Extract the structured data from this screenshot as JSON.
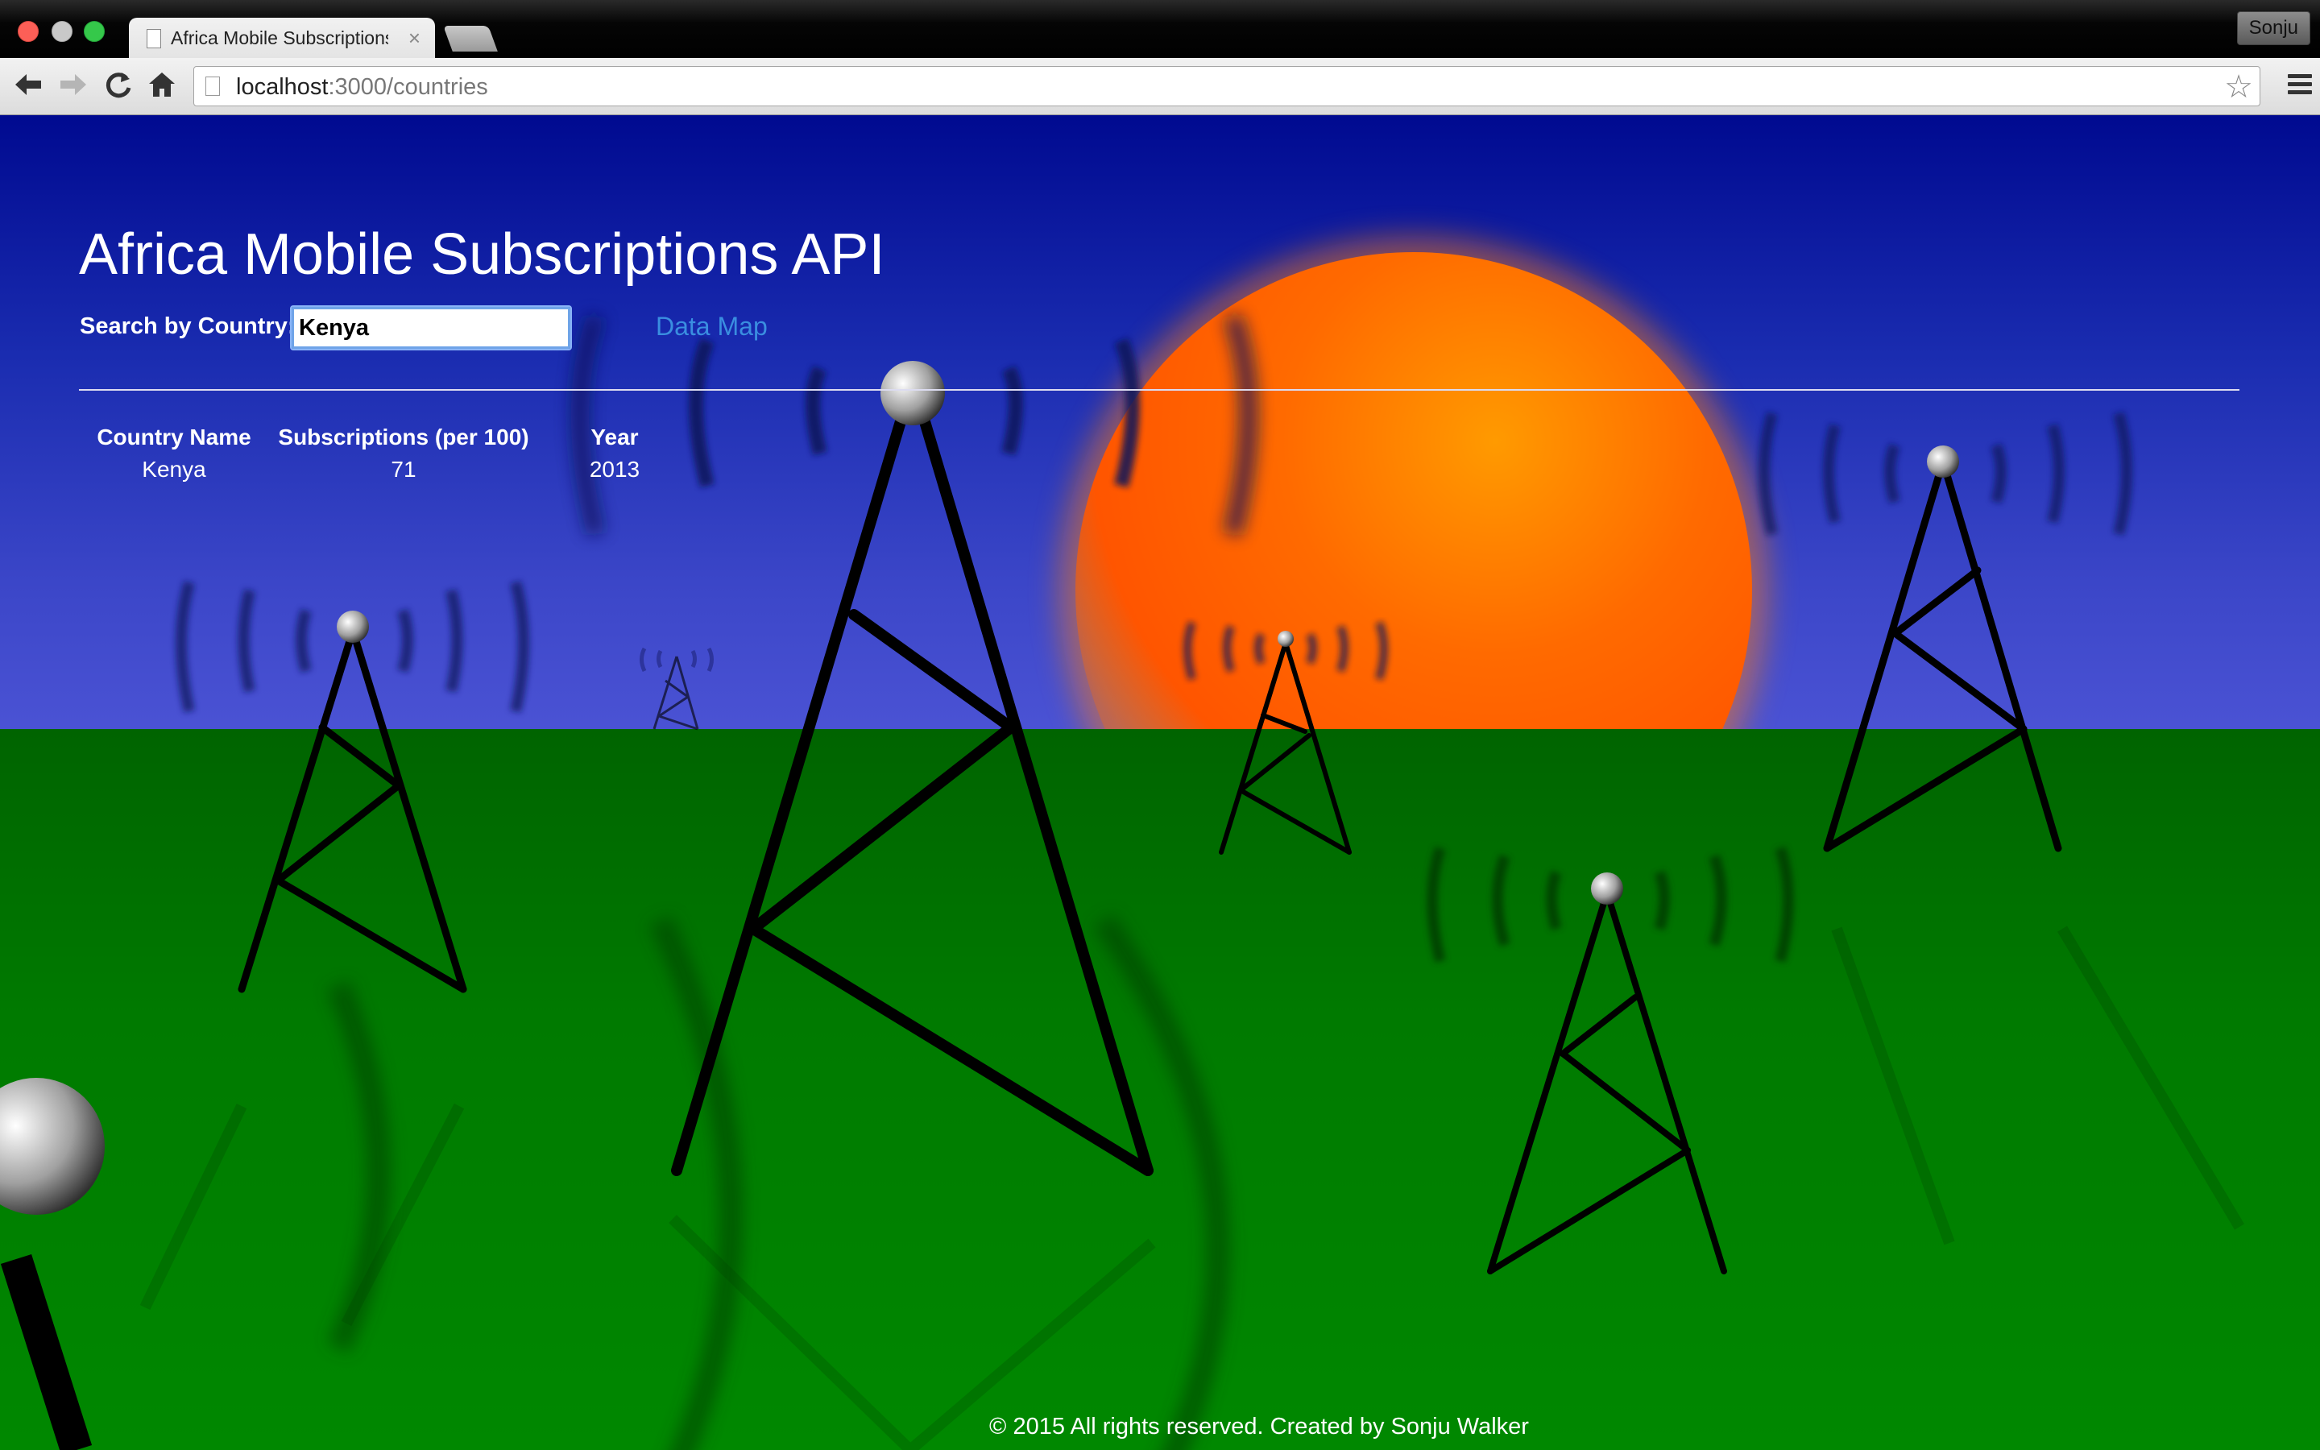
{
  "browser": {
    "tab_title": "Africa Mobile Subscriptions API",
    "url_host": "localhost",
    "url_rest": ":3000/countries",
    "profile_name": "Sonju"
  },
  "page": {
    "title": "Africa Mobile Subscriptions API",
    "search": {
      "label": "Search by Country:",
      "value": "Kenya"
    },
    "data_map_link": "Data Map",
    "table": {
      "headers": [
        "Country Name",
        "Subscriptions (per 100)",
        "Year"
      ],
      "rows": [
        [
          "Kenya",
          "71",
          "2013"
        ]
      ]
    },
    "footer": "© 2015 All rights reserved. Created by Sonju Walker"
  },
  "colors": {
    "sky_top": "#000a90",
    "sky_bottom": "#5f63e6",
    "ground": "#007a00",
    "sun": "#ff6a00",
    "link": "#3a8ee0"
  },
  "icons": {
    "back": "back-arrow-icon",
    "forward": "forward-arrow-icon",
    "reload": "reload-icon",
    "home": "home-icon",
    "bookmark": "star-icon",
    "menu": "hamburger-menu-icon"
  }
}
